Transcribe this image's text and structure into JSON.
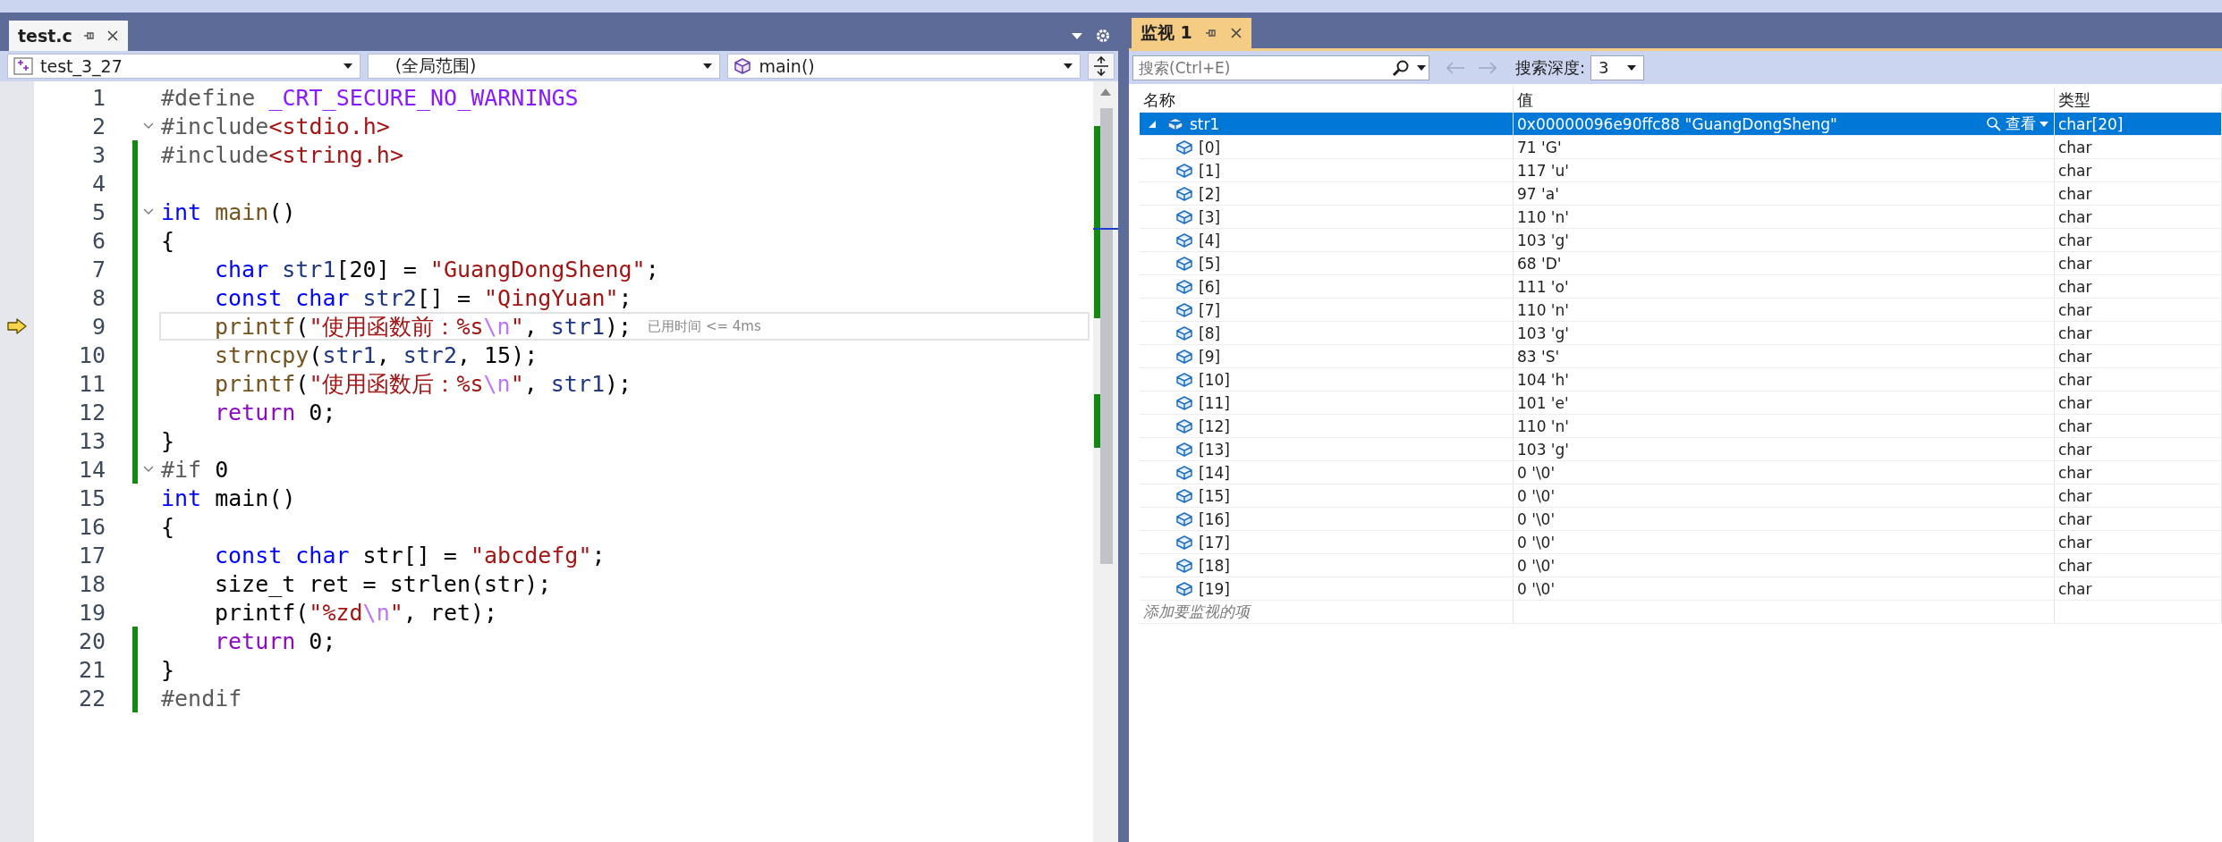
{
  "editor": {
    "tab": {
      "title": "test.c",
      "selected": true
    },
    "nav": {
      "project": "test_3_27",
      "scope": "(全局范围)",
      "member": "main()"
    },
    "lines": [
      {
        "number": "1",
        "changed": false,
        "fold": false,
        "current": false,
        "indented": false,
        "tokens": [
          {
            "text": "#define",
            "kind": "pre"
          },
          {
            "text": " _CRT_SECURE_NO_WARNINGS",
            "kind": "macro"
          }
        ]
      },
      {
        "number": "2",
        "changed": false,
        "fold": true,
        "current": false,
        "indented": false,
        "tokens": [
          {
            "text": "#include",
            "kind": "pre"
          },
          {
            "text": "<stdio.h>",
            "kind": "string"
          }
        ]
      },
      {
        "number": "3",
        "changed": true,
        "fold": false,
        "current": false,
        "indented": false,
        "tokens": [
          {
            "text": "#include",
            "kind": "pre"
          },
          {
            "text": "<string.h>",
            "kind": "string"
          }
        ]
      },
      {
        "number": "4",
        "changed": true,
        "fold": false,
        "current": false
      },
      {
        "number": "5",
        "changed": true,
        "fold": true,
        "current": false,
        "indented": false,
        "tokens": [
          {
            "text": "int",
            "kind": "keyword"
          },
          {
            "text": " main",
            "kind": "function"
          },
          {
            "text": "()",
            "kind": "plain"
          }
        ]
      },
      {
        "number": "6",
        "changed": true,
        "fold": false,
        "current": false,
        "indented": false,
        "tokens": [
          {
            "text": "{",
            "kind": "plain"
          }
        ]
      },
      {
        "number": "7",
        "changed": true,
        "fold": false,
        "current": false,
        "indented": true,
        "tokens": [
          {
            "text": "char",
            "kind": "keyword"
          },
          {
            "text": " str1",
            "kind": "variable"
          },
          {
            "text": "[20] = ",
            "kind": "plain"
          },
          {
            "text": "\"GuangDongSheng\"",
            "kind": "string"
          },
          {
            "text": ";",
            "kind": "plain"
          }
        ]
      },
      {
        "number": "8",
        "changed": true,
        "fold": false,
        "current": false,
        "indented": true,
        "tokens": [
          {
            "text": "const char",
            "kind": "keyword"
          },
          {
            "text": " str2",
            "kind": "variable"
          },
          {
            "text": "[] = ",
            "kind": "plain"
          },
          {
            "text": "\"QingYuan\"",
            "kind": "string"
          },
          {
            "text": ";",
            "kind": "plain"
          }
        ]
      },
      {
        "number": "9",
        "changed": true,
        "fold": false,
        "current": true,
        "indented": true,
        "hint": "已用时间 <= 4ms",
        "tokens": [
          {
            "text": "printf",
            "kind": "function"
          },
          {
            "text": "(",
            "kind": "plain"
          },
          {
            "text": "\"使用函数前：%s",
            "kind": "string"
          },
          {
            "text": "\\n",
            "kind": "escape"
          },
          {
            "text": "\"",
            "kind": "string"
          },
          {
            "text": ", ",
            "kind": "plain"
          },
          {
            "text": "str1",
            "kind": "variable"
          },
          {
            "text": ");",
            "kind": "plain"
          }
        ]
      },
      {
        "number": "10",
        "changed": true,
        "fold": false,
        "current": false,
        "indented": true,
        "tokens": [
          {
            "text": "strncpy",
            "kind": "function"
          },
          {
            "text": "(",
            "kind": "plain"
          },
          {
            "text": "str1",
            "kind": "variable"
          },
          {
            "text": ", ",
            "kind": "plain"
          },
          {
            "text": "str2",
            "kind": "variable"
          },
          {
            "text": ", 15);",
            "kind": "plain"
          }
        ]
      },
      {
        "number": "11",
        "changed": true,
        "fold": false,
        "current": false,
        "indented": true,
        "tokens": [
          {
            "text": "printf",
            "kind": "function"
          },
          {
            "text": "(",
            "kind": "plain"
          },
          {
            "text": "\"使用函数后：%s",
            "kind": "string"
          },
          {
            "text": "\\n",
            "kind": "escape"
          },
          {
            "text": "\"",
            "kind": "string"
          },
          {
            "text": ", ",
            "kind": "plain"
          },
          {
            "text": "str1",
            "kind": "variable"
          },
          {
            "text": ");",
            "kind": "plain"
          }
        ]
      },
      {
        "number": "12",
        "changed": true,
        "fold": false,
        "current": false,
        "indented": true,
        "tokens": [
          {
            "text": "return",
            "kind": "control"
          },
          {
            "text": " 0;",
            "kind": "plain"
          }
        ]
      },
      {
        "number": "13",
        "changed": true,
        "fold": false,
        "current": false,
        "indented": false,
        "tokens": [
          {
            "text": "}",
            "kind": "plain"
          }
        ]
      },
      {
        "number": "14",
        "changed": true,
        "fold": true,
        "current": false,
        "indented": false,
        "tokens": [
          {
            "text": "#if",
            "kind": "pre"
          },
          {
            "text": " 0",
            "kind": "plain"
          }
        ]
      },
      {
        "number": "15",
        "changed": false,
        "fold": false,
        "current": false,
        "indented": false,
        "tokens": [
          {
            "text": "int",
            "kind": "keyword"
          },
          {
            "text": " main()",
            "kind": "plain"
          }
        ]
      },
      {
        "number": "16",
        "changed": false,
        "fold": false,
        "current": false,
        "indented": false,
        "tokens": [
          {
            "text": "{",
            "kind": "plain"
          }
        ]
      },
      {
        "number": "17",
        "changed": false,
        "fold": false,
        "current": false,
        "indented": true,
        "tokens": [
          {
            "text": "const char",
            "kind": "keyword"
          },
          {
            "text": " str[] = ",
            "kind": "plain"
          },
          {
            "text": "\"abcdefg\"",
            "kind": "string"
          },
          {
            "text": ";",
            "kind": "plain"
          }
        ]
      },
      {
        "number": "18",
        "changed": false,
        "fold": false,
        "current": false,
        "indented": true,
        "tokens": [
          {
            "text": "size_t ret = strlen(str);",
            "kind": "plain"
          }
        ]
      },
      {
        "number": "19",
        "changed": false,
        "fold": false,
        "current": false,
        "indented": true,
        "tokens": [
          {
            "text": "printf(",
            "kind": "plain"
          },
          {
            "text": "\"%zd",
            "kind": "string"
          },
          {
            "text": "\\n",
            "kind": "escape"
          },
          {
            "text": "\"",
            "kind": "string"
          },
          {
            "text": ", ret);",
            "kind": "plain"
          }
        ]
      },
      {
        "number": "20",
        "changed": true,
        "fold": false,
        "current": false,
        "indented": true,
        "tokens": [
          {
            "text": "return",
            "kind": "control"
          },
          {
            "text": " 0;",
            "kind": "plain"
          }
        ]
      },
      {
        "number": "21",
        "changed": true,
        "fold": false,
        "current": false,
        "indented": false,
        "tokens": [
          {
            "text": "}",
            "kind": "plain"
          }
        ]
      },
      {
        "number": "22",
        "changed": true,
        "fold": false,
        "current": false,
        "indented": false,
        "tokens": [
          {
            "text": "#endif",
            "kind": "pre"
          }
        ]
      }
    ]
  },
  "watch": {
    "tab": {
      "title": "监视 1",
      "selected": true
    },
    "search": {
      "placeholder": "搜索(Ctrl+E)"
    },
    "depth_label": "搜索深度:",
    "depth": "3",
    "columns": [
      "名称",
      "值",
      "类型"
    ],
    "rows": [
      {
        "name": "str1",
        "value": "0x00000096e90ffc88 \"GuangDongSheng\"",
        "type": "char[20]",
        "selected": true,
        "expanded": true,
        "view": "查看",
        "children": [
          {
            "name": "[0]",
            "value": "71 'G'",
            "type": "char",
            "selected": false
          },
          {
            "name": "[1]",
            "value": "117 'u'",
            "type": "char",
            "selected": false
          },
          {
            "name": "[2]",
            "value": "97 'a'",
            "type": "char",
            "selected": false
          },
          {
            "name": "[3]",
            "value": "110 'n'",
            "type": "char",
            "selected": false
          },
          {
            "name": "[4]",
            "value": "103 'g'",
            "type": "char",
            "selected": false
          },
          {
            "name": "[5]",
            "value": "68 'D'",
            "type": "char",
            "selected": false
          },
          {
            "name": "[6]",
            "value": "111 'o'",
            "type": "char",
            "selected": false
          },
          {
            "name": "[7]",
            "value": "110 'n'",
            "type": "char",
            "selected": false
          },
          {
            "name": "[8]",
            "value": "103 'g'",
            "type": "char",
            "selected": false
          },
          {
            "name": "[9]",
            "value": "83 'S'",
            "type": "char",
            "selected": false
          },
          {
            "name": "[10]",
            "value": "104 'h'",
            "type": "char",
            "selected": false
          },
          {
            "name": "[11]",
            "value": "101 'e'",
            "type": "char",
            "selected": false
          },
          {
            "name": "[12]",
            "value": "110 'n'",
            "type": "char",
            "selected": false
          },
          {
            "name": "[13]",
            "value": "103 'g'",
            "type": "char",
            "selected": false
          },
          {
            "name": "[14]",
            "value": "0 '\\0'",
            "type": "char",
            "selected": false
          },
          {
            "name": "[15]",
            "value": "0 '\\0'",
            "type": "char",
            "selected": false
          },
          {
            "name": "[16]",
            "value": "0 '\\0'",
            "type": "char",
            "selected": false
          },
          {
            "name": "[17]",
            "value": "0 '\\0'",
            "type": "char",
            "selected": false
          },
          {
            "name": "[18]",
            "value": "0 '\\0'",
            "type": "char",
            "selected": false
          },
          {
            "name": "[19]",
            "value": "0 '\\0'",
            "type": "char",
            "selected": false
          }
        ]
      }
    ],
    "add_placeholder": "添加要监视的项"
  }
}
